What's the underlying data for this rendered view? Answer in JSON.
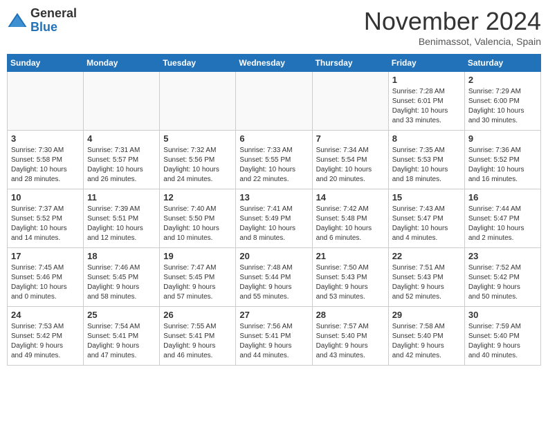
{
  "logo": {
    "line1": "General",
    "line2": "Blue"
  },
  "title": "November 2024",
  "location": "Benimassot, Valencia, Spain",
  "days_header": [
    "Sunday",
    "Monday",
    "Tuesday",
    "Wednesday",
    "Thursday",
    "Friday",
    "Saturday"
  ],
  "weeks": [
    [
      {
        "day": "",
        "info": ""
      },
      {
        "day": "",
        "info": ""
      },
      {
        "day": "",
        "info": ""
      },
      {
        "day": "",
        "info": ""
      },
      {
        "day": "",
        "info": ""
      },
      {
        "day": "1",
        "info": "Sunrise: 7:28 AM\nSunset: 6:01 PM\nDaylight: 10 hours\nand 33 minutes."
      },
      {
        "day": "2",
        "info": "Sunrise: 7:29 AM\nSunset: 6:00 PM\nDaylight: 10 hours\nand 30 minutes."
      }
    ],
    [
      {
        "day": "3",
        "info": "Sunrise: 7:30 AM\nSunset: 5:58 PM\nDaylight: 10 hours\nand 28 minutes."
      },
      {
        "day": "4",
        "info": "Sunrise: 7:31 AM\nSunset: 5:57 PM\nDaylight: 10 hours\nand 26 minutes."
      },
      {
        "day": "5",
        "info": "Sunrise: 7:32 AM\nSunset: 5:56 PM\nDaylight: 10 hours\nand 24 minutes."
      },
      {
        "day": "6",
        "info": "Sunrise: 7:33 AM\nSunset: 5:55 PM\nDaylight: 10 hours\nand 22 minutes."
      },
      {
        "day": "7",
        "info": "Sunrise: 7:34 AM\nSunset: 5:54 PM\nDaylight: 10 hours\nand 20 minutes."
      },
      {
        "day": "8",
        "info": "Sunrise: 7:35 AM\nSunset: 5:53 PM\nDaylight: 10 hours\nand 18 minutes."
      },
      {
        "day": "9",
        "info": "Sunrise: 7:36 AM\nSunset: 5:52 PM\nDaylight: 10 hours\nand 16 minutes."
      }
    ],
    [
      {
        "day": "10",
        "info": "Sunrise: 7:37 AM\nSunset: 5:52 PM\nDaylight: 10 hours\nand 14 minutes."
      },
      {
        "day": "11",
        "info": "Sunrise: 7:39 AM\nSunset: 5:51 PM\nDaylight: 10 hours\nand 12 minutes."
      },
      {
        "day": "12",
        "info": "Sunrise: 7:40 AM\nSunset: 5:50 PM\nDaylight: 10 hours\nand 10 minutes."
      },
      {
        "day": "13",
        "info": "Sunrise: 7:41 AM\nSunset: 5:49 PM\nDaylight: 10 hours\nand 8 minutes."
      },
      {
        "day": "14",
        "info": "Sunrise: 7:42 AM\nSunset: 5:48 PM\nDaylight: 10 hours\nand 6 minutes."
      },
      {
        "day": "15",
        "info": "Sunrise: 7:43 AM\nSunset: 5:47 PM\nDaylight: 10 hours\nand 4 minutes."
      },
      {
        "day": "16",
        "info": "Sunrise: 7:44 AM\nSunset: 5:47 PM\nDaylight: 10 hours\nand 2 minutes."
      }
    ],
    [
      {
        "day": "17",
        "info": "Sunrise: 7:45 AM\nSunset: 5:46 PM\nDaylight: 10 hours\nand 0 minutes."
      },
      {
        "day": "18",
        "info": "Sunrise: 7:46 AM\nSunset: 5:45 PM\nDaylight: 9 hours\nand 58 minutes."
      },
      {
        "day": "19",
        "info": "Sunrise: 7:47 AM\nSunset: 5:45 PM\nDaylight: 9 hours\nand 57 minutes."
      },
      {
        "day": "20",
        "info": "Sunrise: 7:48 AM\nSunset: 5:44 PM\nDaylight: 9 hours\nand 55 minutes."
      },
      {
        "day": "21",
        "info": "Sunrise: 7:50 AM\nSunset: 5:43 PM\nDaylight: 9 hours\nand 53 minutes."
      },
      {
        "day": "22",
        "info": "Sunrise: 7:51 AM\nSunset: 5:43 PM\nDaylight: 9 hours\nand 52 minutes."
      },
      {
        "day": "23",
        "info": "Sunrise: 7:52 AM\nSunset: 5:42 PM\nDaylight: 9 hours\nand 50 minutes."
      }
    ],
    [
      {
        "day": "24",
        "info": "Sunrise: 7:53 AM\nSunset: 5:42 PM\nDaylight: 9 hours\nand 49 minutes."
      },
      {
        "day": "25",
        "info": "Sunrise: 7:54 AM\nSunset: 5:41 PM\nDaylight: 9 hours\nand 47 minutes."
      },
      {
        "day": "26",
        "info": "Sunrise: 7:55 AM\nSunset: 5:41 PM\nDaylight: 9 hours\nand 46 minutes."
      },
      {
        "day": "27",
        "info": "Sunrise: 7:56 AM\nSunset: 5:41 PM\nDaylight: 9 hours\nand 44 minutes."
      },
      {
        "day": "28",
        "info": "Sunrise: 7:57 AM\nSunset: 5:40 PM\nDaylight: 9 hours\nand 43 minutes."
      },
      {
        "day": "29",
        "info": "Sunrise: 7:58 AM\nSunset: 5:40 PM\nDaylight: 9 hours\nand 42 minutes."
      },
      {
        "day": "30",
        "info": "Sunrise: 7:59 AM\nSunset: 5:40 PM\nDaylight: 9 hours\nand 40 minutes."
      }
    ]
  ]
}
